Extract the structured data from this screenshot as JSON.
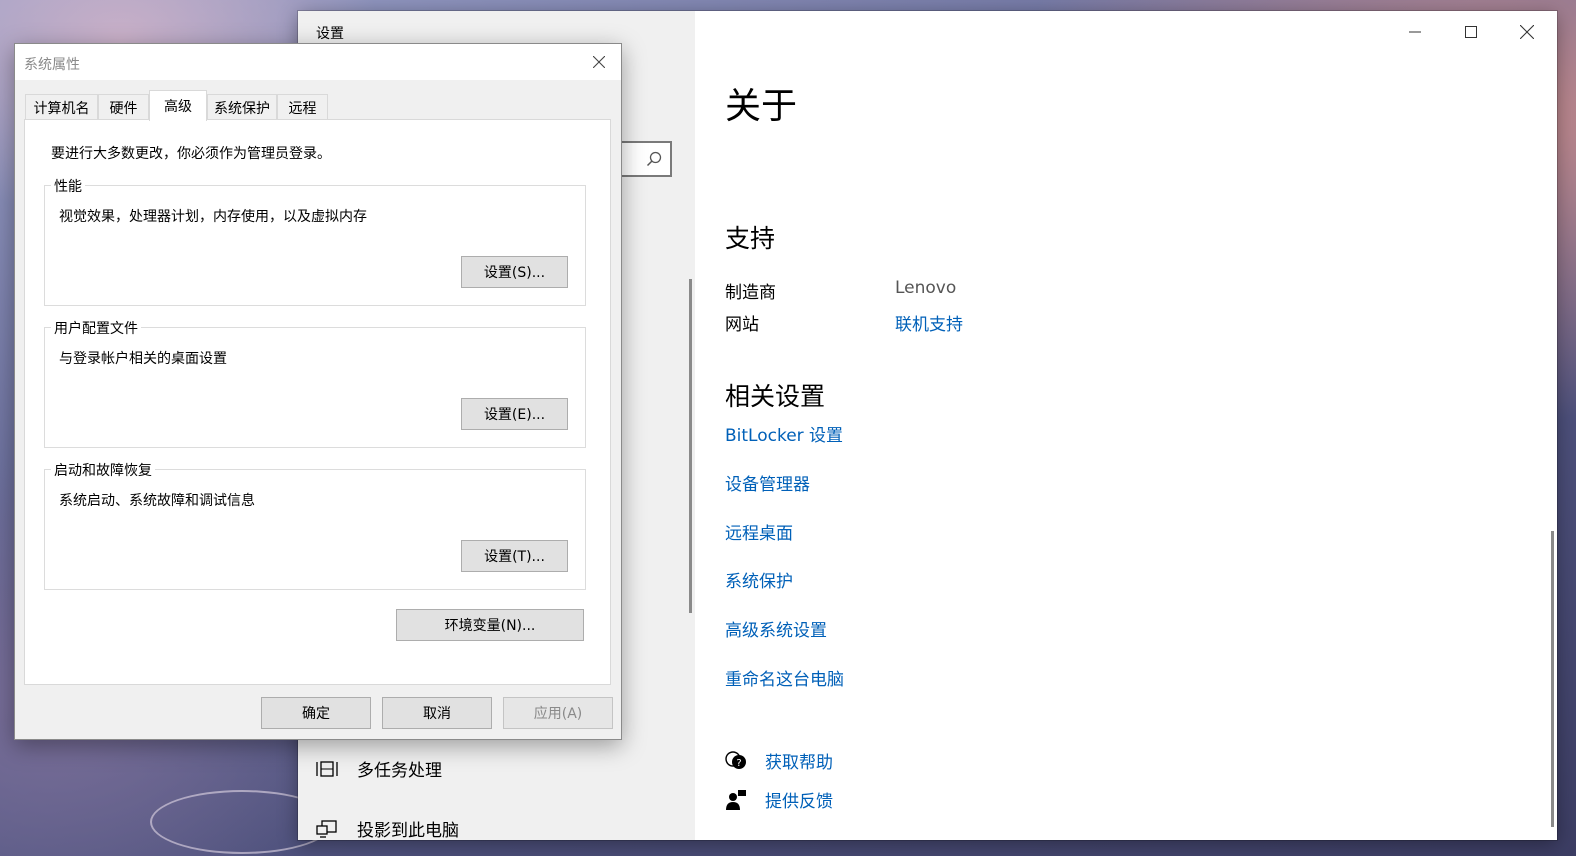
{
  "settings_window": {
    "title": "设置",
    "page_title": "关于",
    "support": {
      "heading": "支持",
      "manufacturer_label": "制造商",
      "manufacturer_value": "Lenovo",
      "website_label": "网站",
      "website_link": "联机支持"
    },
    "related": {
      "heading": "相关设置",
      "links": [
        "BitLocker 设置",
        "设备管理器",
        "远程桌面",
        "系统保护",
        "高级系统设置",
        "重命名这台电脑"
      ]
    },
    "help": {
      "get_help": "获取帮助",
      "feedback": "提供反馈"
    },
    "nav": {
      "multitasking": "多任务处理",
      "projecting": "投影到此电脑"
    },
    "icons": {
      "search": "search-icon",
      "minimize": "minimize-icon",
      "maximize": "maximize-icon",
      "close": "close-icon"
    },
    "link_color": "#0060b8"
  },
  "dialog": {
    "title": "系统属性",
    "tabs": [
      "计算机名",
      "硬件",
      "高级",
      "系统保护",
      "远程"
    ],
    "active_tab": "高级",
    "notice": "要进行大多数更改，你必须作为管理员登录。",
    "performance": {
      "legend": "性能",
      "desc": "视觉效果，处理器计划，内存使用，以及虚拟内存",
      "button": "设置(S)..."
    },
    "profiles": {
      "legend": "用户配置文件",
      "desc": "与登录帐户相关的桌面设置",
      "button": "设置(E)..."
    },
    "startup": {
      "legend": "启动和故障恢复",
      "desc": "系统启动、系统故障和调试信息",
      "button": "设置(T)..."
    },
    "env_button": "环境变量(N)...",
    "ok": "确定",
    "cancel": "取消",
    "apply": "应用(A)"
  }
}
